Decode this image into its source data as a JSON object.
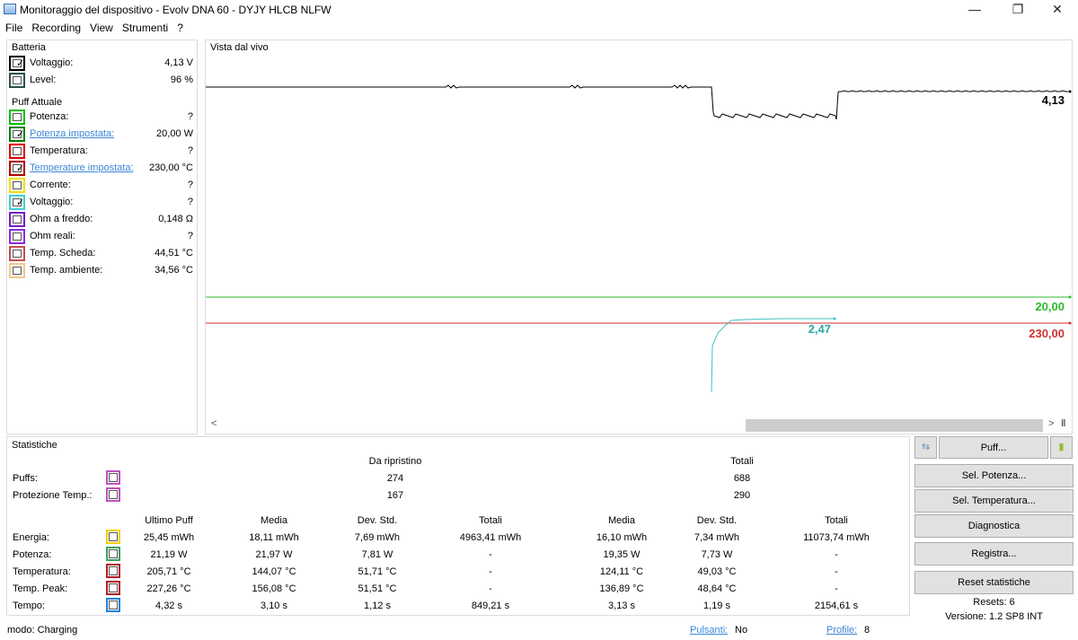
{
  "window": {
    "title": "Monitoraggio del dispositivo - Evolv DNA 60 - DYJY HLCB NLFW",
    "minimize_glyph": "—",
    "restore_glyph": "❐",
    "close_glyph": "✕"
  },
  "menu": [
    "File",
    "Recording",
    "View",
    "Strumenti",
    "?"
  ],
  "battery": {
    "title": "Batteria",
    "rows": [
      {
        "label": "Voltaggio:",
        "value": "4,13 V",
        "checked": true,
        "color": "#000000"
      },
      {
        "label": "Level:",
        "value": "96 %",
        "checked": false,
        "color": "#2f4f4f"
      }
    ]
  },
  "puff": {
    "title": "Puff Attuale",
    "rows": [
      {
        "label": "Potenza:",
        "value": "?",
        "checked": false,
        "color": "#00c000",
        "link": false
      },
      {
        "label": "Potenza impostata:",
        "value": "20,00 W",
        "checked": true,
        "color": "#008000",
        "link": true
      },
      {
        "label": "Temperatura:",
        "value": "?",
        "checked": false,
        "color": "#e00000",
        "link": false
      },
      {
        "label": "Temperature impostata:",
        "value": "230,00 °C",
        "checked": true,
        "color": "#b00000",
        "link": true
      },
      {
        "label": "Corrente:",
        "value": "?",
        "checked": false,
        "color": "#f0e000",
        "link": false
      },
      {
        "label": "Voltaggio:",
        "value": "?",
        "checked": true,
        "color": "#40d0d0",
        "link": false
      },
      {
        "label": "Ohm a freddo:",
        "value": "0,148 Ω",
        "checked": false,
        "color": "#7020c0",
        "link": false
      },
      {
        "label": "Ohm reali:",
        "value": "?",
        "checked": false,
        "color": "#8a2be2",
        "link": false
      },
      {
        "label": "Temp. Scheda:",
        "value": "44,51 °C",
        "checked": false,
        "color": "#c05050",
        "link": false
      },
      {
        "label": "Temp. ambiente:",
        "value": "34,56 °C",
        "checked": false,
        "color": "#f0c890",
        "link": false
      }
    ]
  },
  "liveview": {
    "title": "Vista dal vivo",
    "label_voltage": "4,13",
    "label_power": "20,00",
    "label_temp": "230,00",
    "label_cyan": "2,47",
    "scroll_left": "<",
    "scroll_right": ">",
    "scroll_pause": "‖"
  },
  "chart_data": {
    "type": "line",
    "title": "Vista dal vivo",
    "series": [
      {
        "color": "#000000",
        "last_value": 4.13
      },
      {
        "color": "#2db82d",
        "last_value": 20.0
      },
      {
        "color": "#d03030",
        "last_value": 230.0
      },
      {
        "color": "#40c0c0",
        "last_value": 2.47
      }
    ]
  },
  "stats": {
    "title": "Statistiche",
    "header_reset": "Da ripristino",
    "header_total": "Totali",
    "puffs": {
      "label": "Puffs:",
      "reset": "274",
      "total": "688",
      "color": "#c050c0"
    },
    "protection": {
      "label": "Protezione Temp.:",
      "reset": "167",
      "total": "290",
      "color": "#c050c0"
    },
    "columns": [
      "Ultimo Puff",
      "Media",
      "Dev. Std.",
      "Totali",
      "Media",
      "Dev. Std.",
      "Totali"
    ],
    "rows": [
      {
        "label": "Energia:",
        "color": "#f0d000",
        "values": [
          "25,45 mWh",
          "18,11 mWh",
          "7,69 mWh",
          "4963,41 mWh",
          "16,10 mWh",
          "7,34 mWh",
          "11073,74 mWh"
        ]
      },
      {
        "label": "Potenza:",
        "color": "#40a060",
        "values": [
          "21,19 W",
          "21,97 W",
          "7,81 W",
          "-",
          "19,35 W",
          "7,73 W",
          "-"
        ]
      },
      {
        "label": "Temperatura:",
        "color": "#b02020",
        "values": [
          "205,71 °C",
          "144,07 °C",
          "51,71 °C",
          "-",
          "124,11 °C",
          "49,03 °C",
          "-"
        ]
      },
      {
        "label": "Temp. Peak:",
        "color": "#b02020",
        "values": [
          "227,26 °C",
          "156,08 °C",
          "51,51 °C",
          "-",
          "136,89 °C",
          "48,64 °C",
          "-"
        ]
      },
      {
        "label": "Tempo:",
        "color": "#2080e0",
        "values": [
          "4,32 s",
          "3,10 s",
          "1,12 s",
          "849,21 s",
          "3,13 s",
          "1,19 s",
          "2154,61 s"
        ]
      }
    ]
  },
  "buttons": {
    "puff": "Puff...",
    "sel_potenza": "Sel. Potenza...",
    "sel_temperatura": "Sel. Temperatura...",
    "diagnostica": "Diagnostica",
    "registra": "Registra...",
    "reset_stat": "Reset statistiche"
  },
  "info": {
    "resets": "Resets: 6",
    "version": "Versione: 1.2 SP8 INT"
  },
  "statusbar": {
    "mode": "modo: Charging",
    "pulsanti_label": "Pulsanti:",
    "pulsanti_value": "No",
    "profile_label": "Profile:",
    "profile_value": "8"
  }
}
